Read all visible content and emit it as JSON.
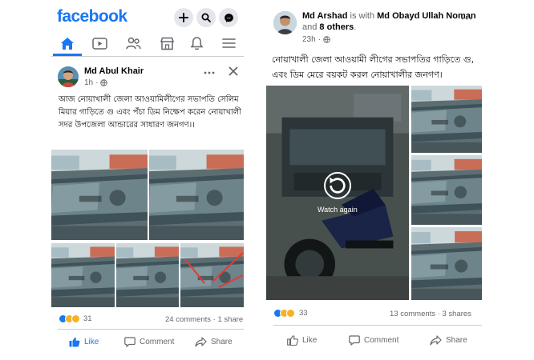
{
  "left": {
    "brand": "facebook",
    "header_icons": [
      "plus-icon",
      "search-icon",
      "messenger-icon"
    ],
    "nav_tabs": [
      {
        "name": "home",
        "icon": "home-icon",
        "active": true
      },
      {
        "name": "watch",
        "icon": "video-icon"
      },
      {
        "name": "groups",
        "icon": "people-icon"
      },
      {
        "name": "marketplace",
        "icon": "store-icon"
      },
      {
        "name": "notifications",
        "icon": "bell-icon"
      },
      {
        "name": "menu",
        "icon": "hamburger-icon"
      }
    ],
    "post": {
      "author": "Md Abul Khair",
      "time": "1h",
      "text": "আজ নোয়াখালী জেলা আওয়ামিলীগের সভাপতি সেলিম মিয়ার গাড়িতে গু এবং পঁচা ডিম নিক্ষেপ করেন নোয়াখালী সদর উপজেলা আন্ডারের সাধারণ জনগণ।।",
      "reaction_count": "31",
      "comments": "24 comments",
      "shares": "1 share",
      "actions": {
        "like": "Like",
        "comment": "Comment",
        "share": "Share"
      }
    }
  },
  "right": {
    "post": {
      "author": "Md Arshad",
      "is_with": "is with",
      "tagged": "Md Obayd Ullah Noman",
      "and": "and",
      "others": "8 others",
      "time": "23h",
      "text": "নোয়াখালী জেলা আওয়ামী লীগের সভাপতির গাড়িতে গু, এবং ডিম মেরে বয়কট করল নোয়াখালীর জনগণ।",
      "watch_again": "Watch again",
      "reaction_count": "33",
      "comments": "13 comments",
      "dot": "·",
      "shares": "3 shares",
      "actions": {
        "like": "Like",
        "comment": "Comment",
        "share": "Share"
      }
    }
  },
  "colors": {
    "brand_blue": "#1877f2",
    "secondary_text": "#65676b",
    "divider": "#ced0d4",
    "icon_bg": "#e4e6eb"
  }
}
